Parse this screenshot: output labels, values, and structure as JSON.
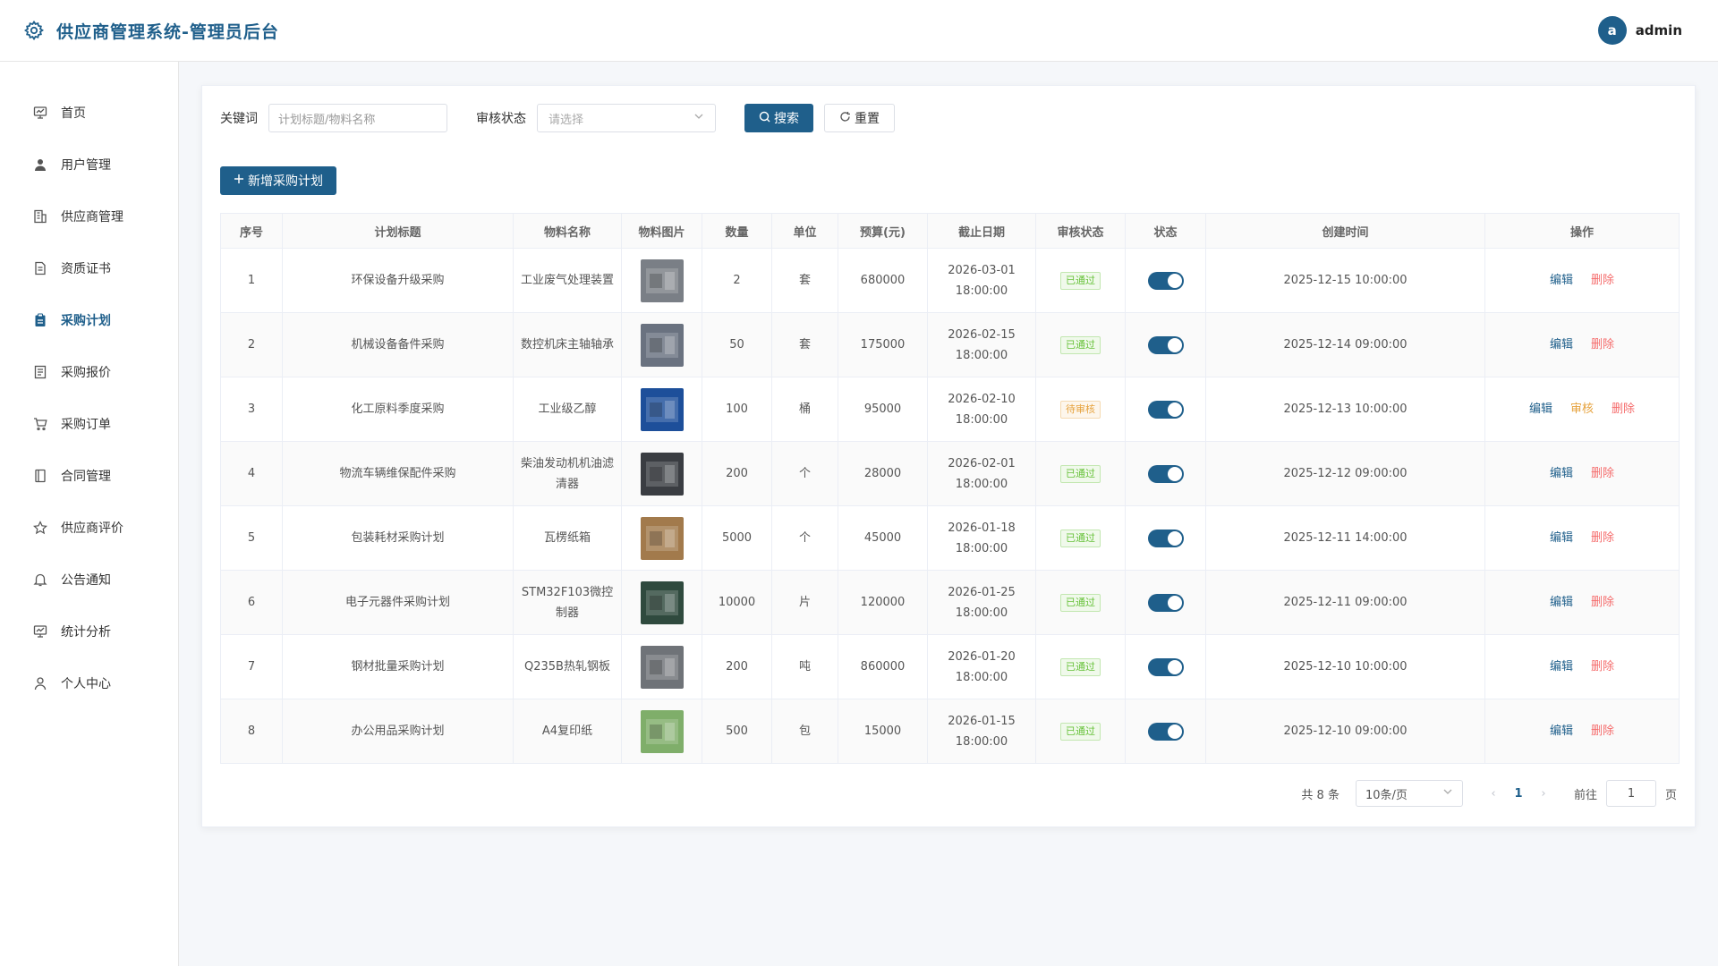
{
  "header": {
    "title": "供应商管理系统-管理员后台",
    "logo_icon": "gear-icon",
    "user": {
      "avatar_letter": "a",
      "name": "admin"
    }
  },
  "sidebar": {
    "items": [
      {
        "label": "首页",
        "icon": "dashboard-icon",
        "active": false
      },
      {
        "label": "用户管理",
        "icon": "user-icon",
        "active": false
      },
      {
        "label": "供应商管理",
        "icon": "building-icon",
        "active": false
      },
      {
        "label": "资质证书",
        "icon": "document-icon",
        "active": false
      },
      {
        "label": "采购计划",
        "icon": "clipboard-icon",
        "active": true
      },
      {
        "label": "采购报价",
        "icon": "quote-icon",
        "active": false
      },
      {
        "label": "采购订单",
        "icon": "cart-icon",
        "active": false
      },
      {
        "label": "合同管理",
        "icon": "contract-icon",
        "active": false
      },
      {
        "label": "供应商评价",
        "icon": "star-icon",
        "active": false
      },
      {
        "label": "公告通知",
        "icon": "bell-icon",
        "active": false
      },
      {
        "label": "统计分析",
        "icon": "chart-icon",
        "active": false
      },
      {
        "label": "个人中心",
        "icon": "person-icon",
        "active": false
      }
    ]
  },
  "filters": {
    "keyword_label": "关键词",
    "keyword_placeholder": "计划标题/物料名称",
    "status_label": "审核状态",
    "status_placeholder": "请选择",
    "search_label": "搜索",
    "reset_label": "重置"
  },
  "add_button_label": "新增采购计划",
  "table": {
    "columns": [
      "序号",
      "计划标题",
      "物料名称",
      "物料图片",
      "数量",
      "单位",
      "预算(元)",
      "截止日期",
      "审核状态",
      "状态",
      "创建时间",
      "操作"
    ],
    "rows": [
      {
        "no": "1",
        "title": "环保设备升级采购",
        "material": "工业废气处理装置",
        "qty": "2",
        "unit": "套",
        "budget": "680000",
        "deadline": "2026-03-01 18:00:00",
        "audit": "已通过",
        "audit_type": "ok",
        "created": "2025-12-15 10:00:00",
        "ops": [
          "编辑",
          "删除"
        ],
        "thumb_color": "#7a7f86"
      },
      {
        "no": "2",
        "title": "机械设备备件采购",
        "material": "数控机床主轴轴承",
        "qty": "50",
        "unit": "套",
        "budget": "175000",
        "deadline": "2026-02-15 18:00:00",
        "audit": "已通过",
        "audit_type": "ok",
        "created": "2025-12-14 09:00:00",
        "ops": [
          "编辑",
          "删除"
        ],
        "thumb_color": "#6a7280"
      },
      {
        "no": "3",
        "title": "化工原料季度采购",
        "material": "工业级乙醇",
        "qty": "100",
        "unit": "桶",
        "budget": "95000",
        "deadline": "2026-02-10 18:00:00",
        "audit": "待审核",
        "audit_type": "pending",
        "created": "2025-12-13 10:00:00",
        "ops": [
          "编辑",
          "审核",
          "删除"
        ],
        "thumb_color": "#1d4f9a"
      },
      {
        "no": "4",
        "title": "物流车辆维保配件采购",
        "material": "柴油发动机机油滤清器",
        "qty": "200",
        "unit": "个",
        "budget": "28000",
        "deadline": "2026-02-01 18:00:00",
        "audit": "已通过",
        "audit_type": "ok",
        "created": "2025-12-12 09:00:00",
        "ops": [
          "编辑",
          "删除"
        ],
        "thumb_color": "#3a3d42"
      },
      {
        "no": "5",
        "title": "包装耗材采购计划",
        "material": "瓦楞纸箱",
        "qty": "5000",
        "unit": "个",
        "budget": "45000",
        "deadline": "2026-01-18 18:00:00",
        "audit": "已通过",
        "audit_type": "ok",
        "created": "2025-12-11 14:00:00",
        "ops": [
          "编辑",
          "删除"
        ],
        "thumb_color": "#a27a4c"
      },
      {
        "no": "6",
        "title": "电子元器件采购计划",
        "material": "STM32F103微控制器",
        "qty": "10000",
        "unit": "片",
        "budget": "120000",
        "deadline": "2026-01-25 18:00:00",
        "audit": "已通过",
        "audit_type": "ok",
        "created": "2025-12-11 09:00:00",
        "ops": [
          "编辑",
          "删除"
        ],
        "thumb_color": "#2f4a3e"
      },
      {
        "no": "7",
        "title": "钢材批量采购计划",
        "material": "Q235B热轧钢板",
        "qty": "200",
        "unit": "吨",
        "budget": "860000",
        "deadline": "2026-01-20 18:00:00",
        "audit": "已通过",
        "audit_type": "ok",
        "created": "2025-12-10 10:00:00",
        "ops": [
          "编辑",
          "删除"
        ],
        "thumb_color": "#6f7378"
      },
      {
        "no": "8",
        "title": "办公用品采购计划",
        "material": "A4复印纸",
        "qty": "500",
        "unit": "包",
        "budget": "15000",
        "deadline": "2026-01-15 18:00:00",
        "audit": "已通过",
        "audit_type": "ok",
        "created": "2025-12-10 09:00:00",
        "ops": [
          "编辑",
          "删除"
        ],
        "thumb_color": "#7fae6a"
      }
    ]
  },
  "pagination": {
    "total_text": "共 8 条",
    "page_size": "10条/页",
    "current_page": "1",
    "goto_label": "前往",
    "goto_value": "1",
    "page_suffix": "页"
  },
  "colors": {
    "primary": "#1f5f8b",
    "success": "#67c23a",
    "warning": "#e6a23c",
    "danger": "#f56c6c"
  }
}
